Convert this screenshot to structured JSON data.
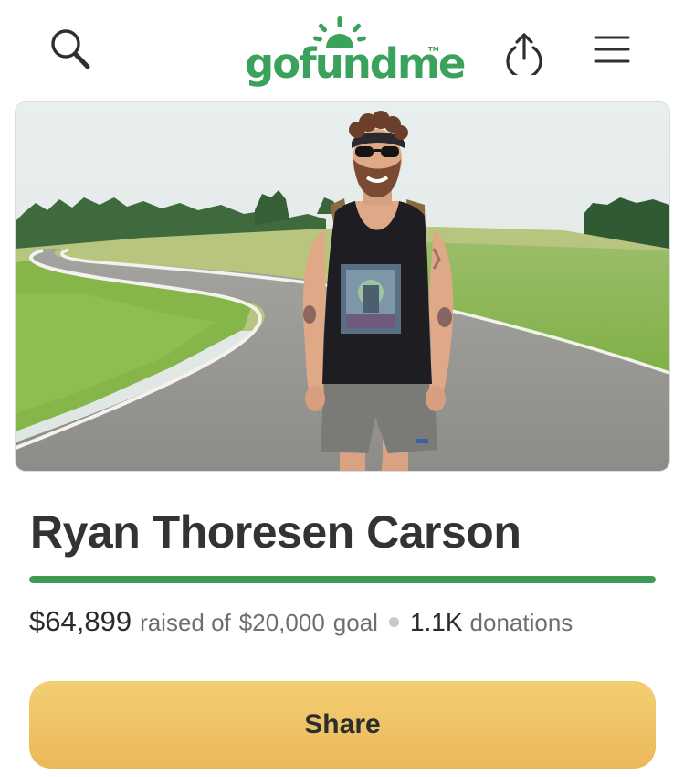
{
  "header": {
    "logo_text": "gofundme",
    "logo_tm": "TM",
    "brand_color": "#3aa25a",
    "icons": {
      "search": "search-icon",
      "share": "upload-share-icon",
      "menu": "hamburger-menu-icon"
    }
  },
  "hero": {
    "image": "campaign-photo"
  },
  "campaign": {
    "title": "Ryan Thoresen Carson",
    "raised": "$64,899",
    "raised_label": "raised of",
    "goal": "$20,000",
    "goal_label": "goal",
    "donations_count": "1.1K",
    "donations_label": "donations",
    "progress_percent": 100,
    "progress_color": "#3e9b56"
  },
  "actions": {
    "share_label": "Share",
    "share_color": "#eab85a"
  }
}
